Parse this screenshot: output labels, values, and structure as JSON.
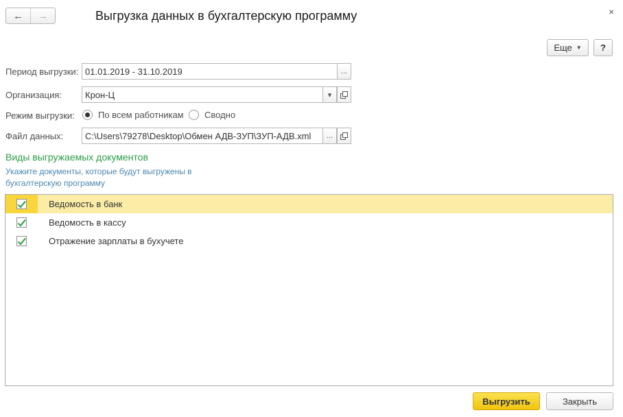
{
  "nav": {
    "back_icon": "←",
    "forward_icon": "→"
  },
  "window": {
    "title": "Выгрузка данных в бухгалтерскую программу",
    "close_icon": "×"
  },
  "toolbar": {
    "more_label": "Еще",
    "more_caret": "▼",
    "help_label": "?"
  },
  "form": {
    "period": {
      "label": "Период выгрузки:",
      "value": "01.01.2019 - 31.10.2019",
      "picker_label": "..."
    },
    "organization": {
      "label": "Организация:",
      "value": "Крон-Ц",
      "dropdown_caret": "▾"
    },
    "mode": {
      "label": "Режим выгрузки:",
      "options": [
        {
          "label": "По всем работникам",
          "selected": true
        },
        {
          "label": "Сводно",
          "selected": false
        }
      ]
    },
    "file": {
      "label": "Файл данных:",
      "value": "C:\\Users\\79278\\Desktop\\Обмен АДВ-ЗУП\\ЗУП-АДВ.xml",
      "picker_label": "..."
    }
  },
  "documents": {
    "title": "Виды выгружаемых документов",
    "hint": "Укажите документы, которые будут выгружены в бухгалтерскую программу",
    "items": [
      {
        "label": "Ведомость в банк",
        "checked": true,
        "selected": true
      },
      {
        "label": "Ведомость в кассу",
        "checked": true,
        "selected": false
      },
      {
        "label": "Отражение зарплаты в бухучете",
        "checked": true,
        "selected": false
      }
    ]
  },
  "footer": {
    "export_label": "Выгрузить",
    "close_label": "Закрыть"
  },
  "colors": {
    "accent_yellow": "#f8d73c",
    "selected_row": "#fbeca6",
    "section_green": "#2b9b47",
    "hint_blue": "#4a86b0",
    "check_green": "#3aa351"
  }
}
